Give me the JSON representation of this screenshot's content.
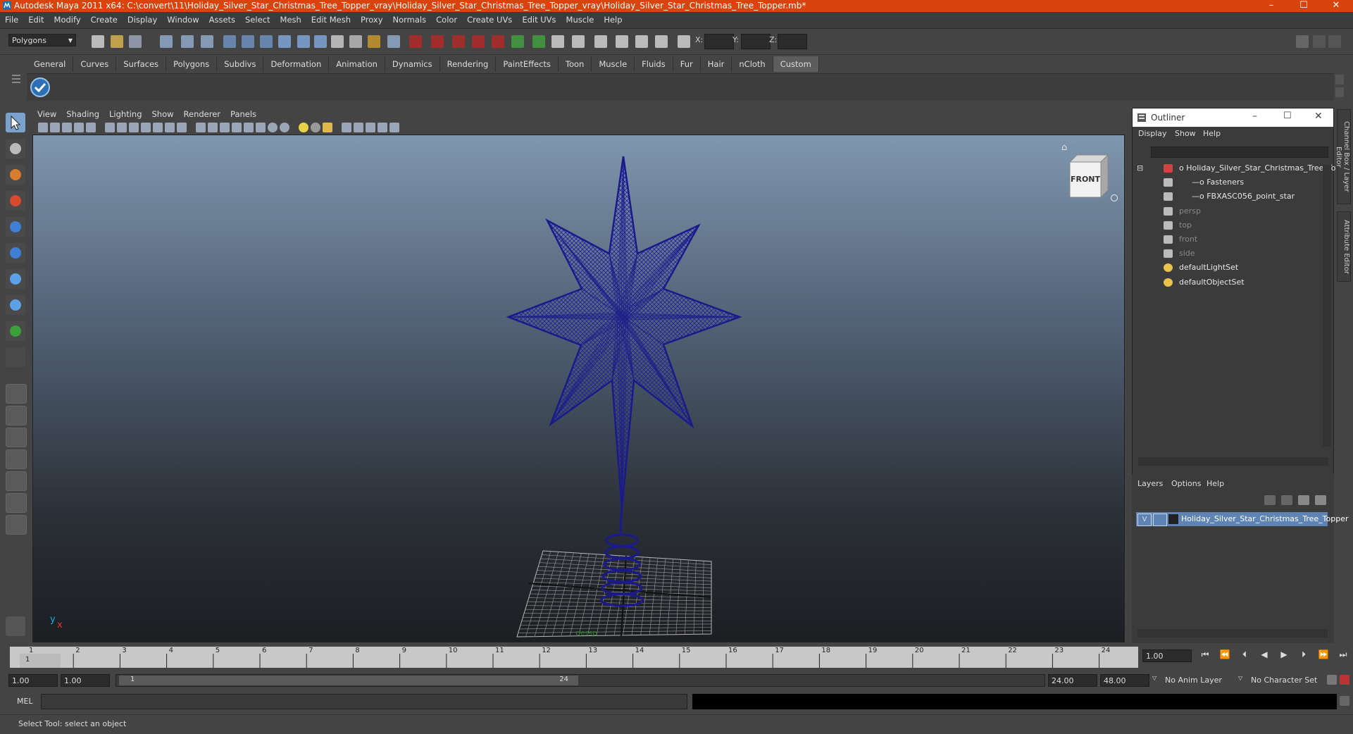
{
  "window": {
    "title": "Autodesk Maya 2011 x64: C:\\convert\\11\\Holiday_Silver_Star_Christmas_Tree_Topper_vray\\Holiday_Silver_Star_Christmas_Tree_Topper_vray\\Holiday_Silver_Star_Christmas_Tree_Topper.mb*",
    "minimize": "–",
    "maximize": "☐",
    "close": "✕"
  },
  "menubar": [
    "File",
    "Edit",
    "Modify",
    "Create",
    "Display",
    "Window",
    "Assets",
    "Select",
    "Mesh",
    "Edit Mesh",
    "Proxy",
    "Normals",
    "Color",
    "Create UVs",
    "Edit UVs",
    "Muscle",
    "Help"
  ],
  "statusline": {
    "mode": "Polygons",
    "x_label": "X:",
    "y_label": "Y:",
    "z_label": "Z:"
  },
  "shelf": {
    "tabs": [
      "General",
      "Curves",
      "Surfaces",
      "Polygons",
      "Subdivs",
      "Deformation",
      "Animation",
      "Dynamics",
      "Rendering",
      "PaintEffects",
      "Toon",
      "Muscle",
      "Fluids",
      "Fur",
      "Hair",
      "nCloth",
      "Custom"
    ],
    "active_tab": "Custom"
  },
  "viewport": {
    "menu": [
      "View",
      "Shading",
      "Lighting",
      "Show",
      "Renderer",
      "Panels"
    ],
    "camera_label": "persp",
    "viewcube_label": "FRONT",
    "axis_y": "y",
    "axis_x": "x",
    "wire_color": "#1a1a8c"
  },
  "outliner": {
    "title": "Outliner",
    "menu": [
      "Display",
      "Show",
      "Help"
    ],
    "items": [
      {
        "label": "Holiday_Silver_Star_Christmas_Tree_To",
        "dim": false
      },
      {
        "label": "Fasteners",
        "dim": false
      },
      {
        "label": "FBXASC056_point_star",
        "dim": false
      },
      {
        "label": "persp",
        "dim": true
      },
      {
        "label": "top",
        "dim": true
      },
      {
        "label": "front",
        "dim": true
      },
      {
        "label": "side",
        "dim": true
      },
      {
        "label": "defaultLightSet",
        "dim": false
      },
      {
        "label": "defaultObjectSet",
        "dim": false
      }
    ]
  },
  "layers": {
    "menu": [
      "Layers",
      "Options",
      "Help"
    ],
    "layer_visible": "V",
    "layer_name": "Holiday_Silver_Star_Christmas_Tree_Topper"
  },
  "timeline": {
    "ticks": [
      "1",
      "2",
      "3",
      "4",
      "5",
      "6",
      "7",
      "8",
      "9",
      "10",
      "11",
      "12",
      "13",
      "14",
      "15",
      "16",
      "17",
      "18",
      "19",
      "20",
      "21",
      "22",
      "23",
      "24"
    ],
    "current_frame": "1.00",
    "current_marker": "1"
  },
  "range": {
    "start": "1.00",
    "playback_start": "1.00",
    "slider_start": "1",
    "slider_end": "24",
    "playback_end": "24.00",
    "end": "48.00",
    "anim_layer": "No Anim Layer",
    "character_set": "No Character Set"
  },
  "command": {
    "label": "MEL"
  },
  "help_line": "Select Tool: select an object",
  "side_tabs": [
    "Channel Box / Layer Editor",
    "Attribute Editor"
  ]
}
